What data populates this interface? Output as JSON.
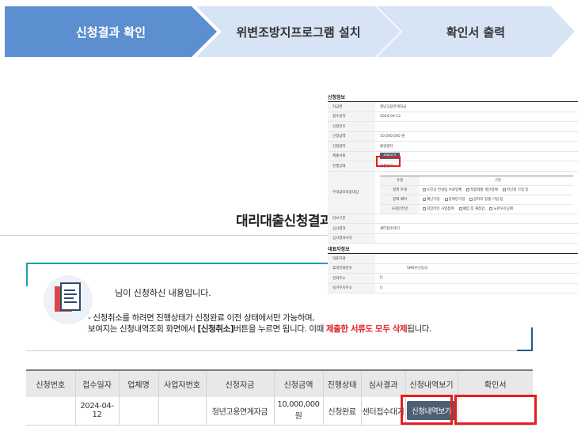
{
  "steps": [
    {
      "label": "신청결과 확인",
      "active": true
    },
    {
      "label": "위변조방지프로그램 설치",
      "active": false
    },
    {
      "label": "확인서 출력",
      "active": false
    }
  ],
  "page_title": "대리대출신청결과",
  "notice": {
    "user_text": "님이 신청하신 내용입니다.",
    "line1": "- 신청취소를 하려면 진행상태가 신청완료 이전 상태에서만 가능하며,",
    "line2_a": "보여지는 신청내역조회 화면에서 ",
    "line2_b": "[신청취소]",
    "line2_c": "버튼을 누르면 됩니다. 이때 ",
    "line2_red": "제출한 서류도 모두 삭제",
    "line2_d": "됩니다."
  },
  "table": {
    "headers": [
      "신청번호",
      "접수일자",
      "업체명",
      "사업자번호",
      "신청자금",
      "신청금액",
      "진행상태",
      "심사결과",
      "신청내역보기",
      "확인서"
    ],
    "row": {
      "app_no": "",
      "date": "2024-04-12",
      "company": "",
      "biz_no": "",
      "fund": "청년고용연계자금",
      "amount": "10,000,000 원",
      "status": "신청완료",
      "review": "센터접수대기",
      "view_btn": "신청내역보기",
      "confirm": ""
    }
  },
  "detail": {
    "section1_title": "신청정보",
    "rows": [
      {
        "k": "자금명",
        "v": "청년고용연계자금"
      },
      {
        "k": "접수일자",
        "v": "2024-04-12"
      },
      {
        "k": "신청번호",
        "v": ""
      },
      {
        "k": "신청금액",
        "v": "10,000,000 원"
      },
      {
        "k": "신청센터",
        "v": "통영센터"
      },
      {
        "k": "제출서류",
        "v": "서류보기"
      },
      {
        "k": "진행상태",
        "v": "신청완료"
      }
    ],
    "priority_label": "우대금리적용대상",
    "sub_header": [
      "유형",
      "구분"
    ],
    "sub_rows": [
      {
        "k": "정책 우대",
        "v": [
          "소진공 컨설팅 수료업체",
          "적합제품 생산업체",
          "혁신형 기업 등"
        ]
      },
      {
        "k": "정책 배려",
        "v": [
          "재난기업",
          "장애인기업",
          "일자리 창출 기업 등"
        ]
      },
      {
        "k": "사회안전망",
        "v": [
          "희망리턴 사업참여",
          "폐업 후 재창업",
          "노란우산공제"
        ]
      }
    ],
    "rows2": [
      {
        "k": "담보구분",
        "v": ""
      },
      {
        "k": "심사결과",
        "v": "센터접수대기"
      },
      {
        "k": "심사결과사유",
        "v": ""
      }
    ],
    "section2_title": "대표자정보",
    "rows3": [
      {
        "k": "대표자명",
        "v": ""
      },
      {
        "k": "휴대전화번호",
        "v": "SMS수신동의"
      },
      {
        "k": "전화주소",
        "v": "[]"
      },
      {
        "k": "실거주지주소",
        "v": "[]"
      }
    ]
  },
  "colors": {
    "step_active": "#5b8fd0",
    "step_inactive": "#d6e4f5",
    "highlight": "#e41f1f",
    "accent": "#1a9fb0"
  }
}
